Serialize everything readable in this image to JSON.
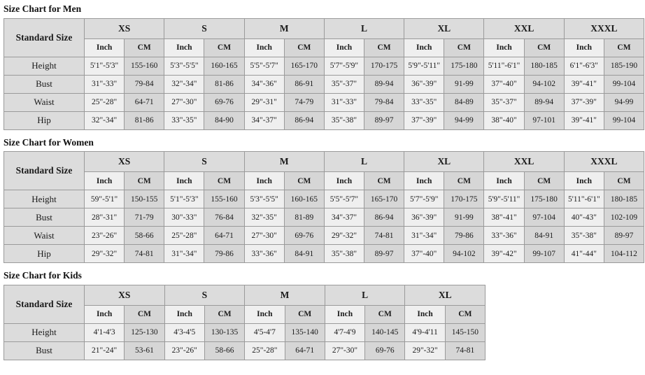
{
  "charts": [
    {
      "id": "men",
      "title": "Size Chart for Men",
      "corner_label": "Standard Size",
      "sizes": [
        "XS",
        "S",
        "M",
        "L",
        "XL",
        "XXL",
        "XXXL"
      ],
      "units": [
        "Inch",
        "CM"
      ],
      "rows": [
        {
          "label": "Height",
          "values": [
            [
              "5'1\"-5'3\"",
              "155-160"
            ],
            [
              "5'3\"-5'5\"",
              "160-165"
            ],
            [
              "5'5\"-5'7\"",
              "165-170"
            ],
            [
              "5'7\"-5'9\"",
              "170-175"
            ],
            [
              "5'9\"-5'11\"",
              "175-180"
            ],
            [
              "5'11\"-6'1\"",
              "180-185"
            ],
            [
              "6'1\"-6'3\"",
              "185-190"
            ]
          ]
        },
        {
          "label": "Bust",
          "values": [
            [
              "31\"-33\"",
              "79-84"
            ],
            [
              "32\"-34\"",
              "81-86"
            ],
            [
              "34\"-36\"",
              "86-91"
            ],
            [
              "35\"-37\"",
              "89-94"
            ],
            [
              "36\"-39\"",
              "91-99"
            ],
            [
              "37\"-40\"",
              "94-102"
            ],
            [
              "39\"-41\"",
              "99-104"
            ]
          ]
        },
        {
          "label": "Waist",
          "values": [
            [
              "25\"-28\"",
              "64-71"
            ],
            [
              "27\"-30\"",
              "69-76"
            ],
            [
              "29\"-31\"",
              "74-79"
            ],
            [
              "31\"-33\"",
              "79-84"
            ],
            [
              "33\"-35\"",
              "84-89"
            ],
            [
              "35\"-37\"",
              "89-94"
            ],
            [
              "37\"-39\"",
              "94-99"
            ]
          ]
        },
        {
          "label": "Hip",
          "values": [
            [
              "32\"-34\"",
              "81-86"
            ],
            [
              "33\"-35\"",
              "84-90"
            ],
            [
              "34\"-37\"",
              "86-94"
            ],
            [
              "35\"-38\"",
              "89-97"
            ],
            [
              "37\"-39\"",
              "94-99"
            ],
            [
              "38\"-40\"",
              "97-101"
            ],
            [
              "39\"-41\"",
              "99-104"
            ]
          ]
        }
      ]
    },
    {
      "id": "women",
      "title": "Size Chart for Women",
      "corner_label": "Standard Size",
      "sizes": [
        "XS",
        "S",
        "M",
        "L",
        "XL",
        "XXL",
        "XXXL"
      ],
      "units": [
        "Inch",
        "CM"
      ],
      "rows": [
        {
          "label": "Height",
          "values": [
            [
              "59\"-5'1\"",
              "150-155"
            ],
            [
              "5'1\"-5'3\"",
              "155-160"
            ],
            [
              "5'3\"-5'5\"",
              "160-165"
            ],
            [
              "5'5\"-5'7\"",
              "165-170"
            ],
            [
              "5'7\"-5'9\"",
              "170-175"
            ],
            [
              "5'9\"-5'11\"",
              "175-180"
            ],
            [
              "5'11\"-6'1\"",
              "180-185"
            ]
          ]
        },
        {
          "label": "Bust",
          "values": [
            [
              "28\"-31\"",
              "71-79"
            ],
            [
              "30\"-33\"",
              "76-84"
            ],
            [
              "32\"-35\"",
              "81-89"
            ],
            [
              "34\"-37\"",
              "86-94"
            ],
            [
              "36\"-39\"",
              "91-99"
            ],
            [
              "38\"-41\"",
              "97-104"
            ],
            [
              "40\"-43\"",
              "102-109"
            ]
          ]
        },
        {
          "label": "Waist",
          "values": [
            [
              "23\"-26\"",
              "58-66"
            ],
            [
              "25\"-28\"",
              "64-71"
            ],
            [
              "27\"-30\"",
              "69-76"
            ],
            [
              "29\"-32\"",
              "74-81"
            ],
            [
              "31\"-34\"",
              "79-86"
            ],
            [
              "33\"-36\"",
              "84-91"
            ],
            [
              "35\"-38\"",
              "89-97"
            ]
          ]
        },
        {
          "label": "Hip",
          "values": [
            [
              "29\"-32\"",
              "74-81"
            ],
            [
              "31\"-34\"",
              "79-86"
            ],
            [
              "33\"-36\"",
              "84-91"
            ],
            [
              "35\"-38\"",
              "89-97"
            ],
            [
              "37\"-40\"",
              "94-102"
            ],
            [
              "39\"-42\"",
              "99-107"
            ],
            [
              "41\"-44\"",
              "104-112"
            ]
          ]
        }
      ]
    },
    {
      "id": "kids",
      "title": "Size Chart for Kids",
      "corner_label": "Standard Size",
      "sizes": [
        "XS",
        "S",
        "M",
        "L",
        "XL"
      ],
      "units": [
        "Inch",
        "CM"
      ],
      "rows": [
        {
          "label": "Height",
          "values": [
            [
              "4'1-4'3",
              "125-130"
            ],
            [
              "4'3-4'5",
              "130-135"
            ],
            [
              "4'5-4'7",
              "135-140"
            ],
            [
              "4'7-4'9",
              "140-145"
            ],
            [
              "4'9-4'11",
              "145-150"
            ]
          ]
        },
        {
          "label": "Bust",
          "values": [
            [
              "21\"-24\"",
              "53-61"
            ],
            [
              "23\"-26\"",
              "58-66"
            ],
            [
              "25\"-28\"",
              "64-71"
            ],
            [
              "27\"-30\"",
              "69-76"
            ],
            [
              "29\"-32\"",
              "74-81"
            ]
          ]
        }
      ]
    }
  ],
  "colors": {
    "page_background": "#ffffff",
    "border": "#9a9a9a",
    "header_background": "#dcdcdc",
    "inch_background": "#efefef",
    "cm_background": "#d6d6d6",
    "text": "#1a1a1a"
  },
  "layout": {
    "men_table_width": 915,
    "women_table_width": 915,
    "kids_table_width": 688,
    "first_column_width": 115
  }
}
